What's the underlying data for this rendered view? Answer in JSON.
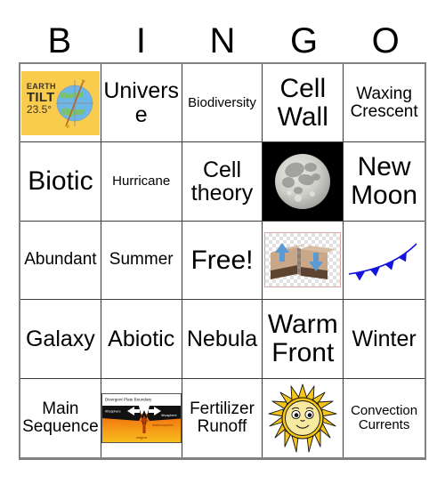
{
  "card": {
    "title_letters": [
      "B",
      "I",
      "N",
      "G",
      "O"
    ],
    "colors": {
      "grid_border": "#808080",
      "cell_border": "#3a3a3a",
      "earth_tilt_bg": "#f9cc4e",
      "moon_bg": "#000000",
      "cold_front_blue": "#1414dc",
      "fault_arrow_blue": "#5b9bd5",
      "sun_yellow": "#f5c518",
      "magma_orange": "#f0a000"
    },
    "rows": [
      [
        {
          "name": "earth-tilt-image",
          "type": "image",
          "image": "earth-tilt-diagram",
          "label_line1": "EARTH",
          "label_line2": "TILT",
          "label_line3": "23.5°"
        },
        {
          "name": "universe",
          "type": "text",
          "text": "Universe",
          "size": "fs-lg"
        },
        {
          "name": "biodiversity",
          "type": "text",
          "text": "Biodiversity",
          "size": "fs-sm"
        },
        {
          "name": "cell-wall",
          "type": "text",
          "text": "Cell Wall",
          "size": "fs-xl"
        },
        {
          "name": "waxing-crescent",
          "type": "text",
          "text": "Waxing Crescent",
          "size": "fs-md"
        }
      ],
      [
        {
          "name": "biotic",
          "type": "text",
          "text": "Biotic",
          "size": "fs-xl"
        },
        {
          "name": "hurricane",
          "type": "text",
          "text": "Hurricane",
          "size": "fs-sm"
        },
        {
          "name": "cell-theory",
          "type": "text",
          "text": "Cell theory",
          "size": "fs-lg"
        },
        {
          "name": "full-moon-image",
          "type": "image",
          "image": "full-moon-photo"
        },
        {
          "name": "new-moon",
          "type": "text",
          "text": "New Moon",
          "size": "fs-xl"
        }
      ],
      [
        {
          "name": "abundant",
          "type": "text",
          "text": "Abundant",
          "size": "fs-md"
        },
        {
          "name": "summer",
          "type": "text",
          "text": "Summer",
          "size": "fs-md"
        },
        {
          "name": "free-space",
          "type": "text",
          "text": "Free!",
          "size": "fs-xl"
        },
        {
          "name": "transform-fault-image",
          "type": "image",
          "image": "transform-fault-diagram"
        },
        {
          "name": "cold-front-image",
          "type": "image",
          "image": "cold-front-symbol"
        }
      ],
      [
        {
          "name": "galaxy",
          "type": "text",
          "text": "Galaxy",
          "size": "fs-lg"
        },
        {
          "name": "abiotic",
          "type": "text",
          "text": "Abiotic",
          "size": "fs-lg"
        },
        {
          "name": "nebula",
          "type": "text",
          "text": "Nebula",
          "size": "fs-lg"
        },
        {
          "name": "warm-front",
          "type": "text",
          "text": "Warm Front",
          "size": "fs-xl"
        },
        {
          "name": "winter",
          "type": "text",
          "text": "Winter",
          "size": "fs-lg"
        }
      ],
      [
        {
          "name": "main-sequence",
          "type": "text",
          "text": "Main Sequence",
          "size": "fs-md"
        },
        {
          "name": "divergent-boundary-image",
          "type": "image",
          "image": "divergent-plate-boundary-diagram"
        },
        {
          "name": "fertilizer-runoff",
          "type": "text",
          "text": "Fertilizer Runoff",
          "size": "fs-md"
        },
        {
          "name": "sun-image",
          "type": "image",
          "image": "cartoon-sun"
        },
        {
          "name": "convection-currents",
          "type": "text",
          "text": "Convection Currents",
          "size": "fs-sm"
        }
      ]
    ],
    "image_labels": {
      "divergent_title": "Divergent Plate Boundary",
      "divergent_left": "lithosphere",
      "divergent_right": "lithosphere",
      "divergent_mid": "asthenosphere",
      "divergent_bottom": "magma"
    }
  }
}
